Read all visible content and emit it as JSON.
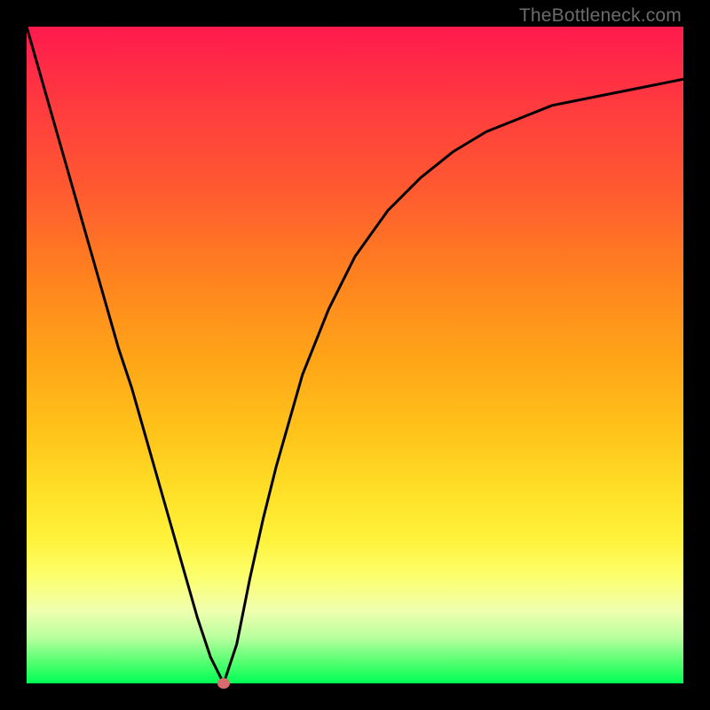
{
  "watermark": "TheBottleneck.com",
  "chart_data": {
    "type": "line",
    "title": "",
    "xlabel": "",
    "ylabel": "",
    "xlim": [
      0,
      1
    ],
    "ylim": [
      0,
      1
    ],
    "x": [
      0.0,
      0.02,
      0.04,
      0.06,
      0.08,
      0.1,
      0.12,
      0.14,
      0.16,
      0.18,
      0.2,
      0.22,
      0.24,
      0.26,
      0.28,
      0.3,
      0.32,
      0.34,
      0.36,
      0.38,
      0.4,
      0.42,
      0.44,
      0.46,
      0.48,
      0.5,
      0.55,
      0.6,
      0.65,
      0.7,
      0.75,
      0.8,
      0.85,
      0.9,
      0.95,
      1.0
    ],
    "values": [
      1.0,
      0.93,
      0.86,
      0.79,
      0.72,
      0.65,
      0.58,
      0.51,
      0.45,
      0.38,
      0.31,
      0.24,
      0.17,
      0.1,
      0.04,
      0.0,
      0.06,
      0.16,
      0.25,
      0.33,
      0.4,
      0.47,
      0.52,
      0.57,
      0.61,
      0.65,
      0.72,
      0.77,
      0.81,
      0.84,
      0.86,
      0.88,
      0.89,
      0.9,
      0.91,
      0.92
    ],
    "marker": {
      "x": 0.3,
      "y": 0.0
    },
    "background_gradient": {
      "top": "#ff1a4d",
      "mid": "#ffcf2a",
      "bottom": "#00ff55"
    },
    "line_color": "#000000",
    "marker_color": "#d96a6f"
  }
}
